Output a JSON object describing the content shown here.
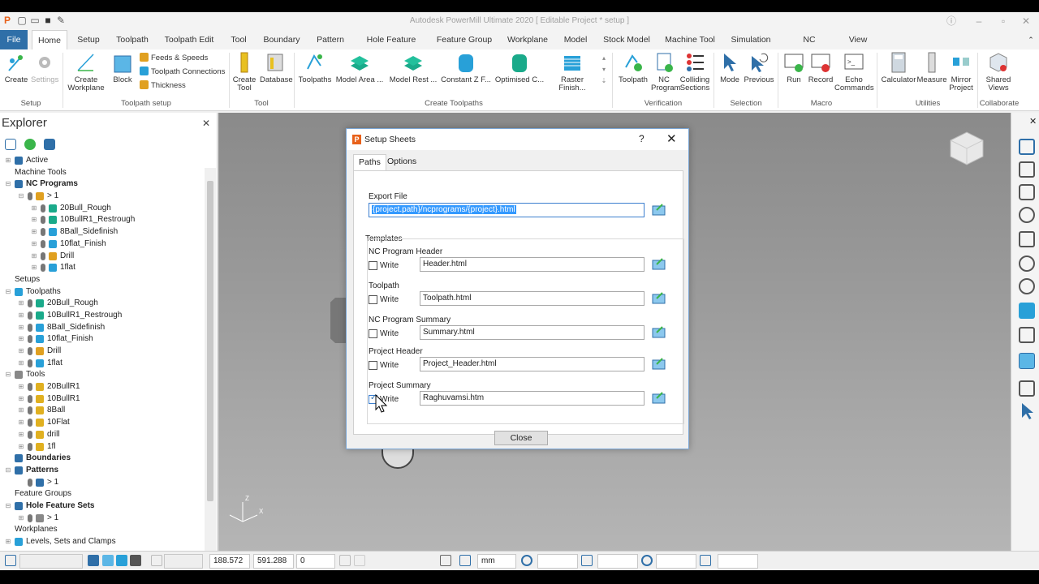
{
  "app": {
    "title": "Autodesk PowerMill Ultimate 2020   [ Editable Project * setup ]"
  },
  "ribbon": {
    "tabs": [
      "File",
      "Home",
      "Setup",
      "Toolpath",
      "Toolpath Edit",
      "Tool",
      "Boundary",
      "Pattern",
      "Hole Feature Set",
      "Feature Group",
      "Workplane",
      "Model",
      "Stock Model",
      "Machine Tool",
      "Simulation",
      "NC Program",
      "View"
    ],
    "groups": {
      "setup": "Setup",
      "toolpath_setup": "Toolpath setup",
      "tool": "Tool",
      "create_toolpaths": "Create Toolpaths",
      "verification": "Verification",
      "selection": "Selection",
      "macro": "Macro",
      "utilities": "Utilities",
      "collaborate": "Collaborate"
    },
    "buttons": {
      "create": "Create",
      "settings": "Settings",
      "create_workplane": "Create Workplane",
      "block": "Block",
      "feeds": "Feeds & Speeds",
      "connections": "Toolpath Connections",
      "thickness": "Thickness",
      "create_tool": "Create Tool",
      "database": "Database",
      "toolpaths": "Toolpaths",
      "model_area": "Model Area ...",
      "model_rest": "Model Rest ...",
      "constant_z": "Constant Z F...",
      "optimised": "Optimised C...",
      "raster": "Raster Finish...",
      "toolpath_v": "Toolpath",
      "nc_program": "NC Program",
      "colliding": "Colliding Sections",
      "mode": "Mode",
      "previous": "Previous",
      "run": "Run",
      "record": "Record",
      "echo": "Echo Commands",
      "calculator": "Calculator",
      "measure": "Measure",
      "mirror": "Mirror Project",
      "shared": "Shared Views"
    }
  },
  "explorer": {
    "title": "Explorer",
    "items": [
      {
        "label": "Active",
        "indent": 0,
        "pm": "+",
        "color": "#2f6fa8",
        "bold": false
      },
      {
        "label": "Machine Tools",
        "indent": 0,
        "pm": "",
        "color": "",
        "bold": false
      },
      {
        "label": "NC Programs",
        "indent": 0,
        "pm": "−",
        "color": "#2f6fa8",
        "bold": true
      },
      {
        "label": "> 1",
        "indent": 1,
        "pm": "−",
        "color": "#e0a020",
        "bold": false
      },
      {
        "label": "20Bull_Rough",
        "indent": 2,
        "pm": "+",
        "color": "#1aaa8a",
        "bold": false
      },
      {
        "label": "10BullR1_Restrough",
        "indent": 2,
        "pm": "+",
        "color": "#1aaa8a",
        "bold": false
      },
      {
        "label": "8Ball_Sidefinish",
        "indent": 2,
        "pm": "+",
        "color": "#28a0d8",
        "bold": false
      },
      {
        "label": "10flat_Finish",
        "indent": 2,
        "pm": "+",
        "color": "#28a0d8",
        "bold": false
      },
      {
        "label": "Drill",
        "indent": 2,
        "pm": "+",
        "color": "#e0a020",
        "bold": false
      },
      {
        "label": "1flat",
        "indent": 2,
        "pm": "+",
        "color": "#28a0d8",
        "bold": false
      },
      {
        "label": "Setups",
        "indent": 0,
        "pm": "",
        "color": "",
        "bold": false
      },
      {
        "label": "Toolpaths",
        "indent": 0,
        "pm": "−",
        "color": "#28a0d8",
        "bold": false
      },
      {
        "label": "20Bull_Rough",
        "indent": 1,
        "pm": "+",
        "color": "#1aaa8a",
        "bold": false
      },
      {
        "label": "10BullR1_Restrough",
        "indent": 1,
        "pm": "+",
        "color": "#1aaa8a",
        "bold": false
      },
      {
        "label": "8Ball_Sidefinish",
        "indent": 1,
        "pm": "+",
        "color": "#28a0d8",
        "bold": false
      },
      {
        "label": "10flat_Finish",
        "indent": 1,
        "pm": "+",
        "color": "#28a0d8",
        "bold": false
      },
      {
        "label": "Drill",
        "indent": 1,
        "pm": "+",
        "color": "#e0a020",
        "bold": false
      },
      {
        "label": "1flat",
        "indent": 1,
        "pm": "+",
        "color": "#28a0d8",
        "bold": false
      },
      {
        "label": "Tools",
        "indent": 0,
        "pm": "−",
        "color": "#888888",
        "bold": false
      },
      {
        "label": "20BullR1",
        "indent": 1,
        "pm": "+",
        "color": "#e0b020",
        "bold": false
      },
      {
        "label": "10BullR1",
        "indent": 1,
        "pm": "+",
        "color": "#e0b020",
        "bold": false
      },
      {
        "label": "8Ball",
        "indent": 1,
        "pm": "+",
        "color": "#e0b020",
        "bold": false
      },
      {
        "label": "10Flat",
        "indent": 1,
        "pm": "+",
        "color": "#e0b020",
        "bold": false
      },
      {
        "label": "drill",
        "indent": 1,
        "pm": "+",
        "color": "#e0b020",
        "bold": false
      },
      {
        "label": "1fl",
        "indent": 1,
        "pm": "+",
        "color": "#e0b020",
        "bold": false
      },
      {
        "label": "Boundaries",
        "indent": 0,
        "pm": "",
        "color": "#2f6fa8",
        "bold": true
      },
      {
        "label": "Patterns",
        "indent": 0,
        "pm": "−",
        "color": "#2f6fa8",
        "bold": true
      },
      {
        "label": "> 1",
        "indent": 1,
        "pm": "",
        "color": "#2f6fa8",
        "bold": false
      },
      {
        "label": "Feature Groups",
        "indent": 0,
        "pm": "",
        "color": "",
        "bold": false
      },
      {
        "label": "Hole Feature Sets",
        "indent": 0,
        "pm": "−",
        "color": "#2f6fa8",
        "bold": true
      },
      {
        "label": "> 1",
        "indent": 1,
        "pm": "+",
        "color": "#888888",
        "bold": false
      },
      {
        "label": "Workplanes",
        "indent": 0,
        "pm": "",
        "color": "",
        "bold": false
      },
      {
        "label": "Levels, Sets and Clamps",
        "indent": 0,
        "pm": "+",
        "color": "#28a0d8",
        "bold": false
      }
    ]
  },
  "status": {
    "x": "188.572",
    "y": "591.288",
    "z": "0",
    "units": "mm"
  },
  "triad": {
    "z": "Z",
    "x": "X"
  },
  "dialog": {
    "title": "Setup Sheets",
    "help": "?",
    "close_x": "✕",
    "tabs": [
      "Paths",
      "Options"
    ],
    "export_label": "Export File",
    "export_value": "{project.path}/ncprograms/{project}.html",
    "templates_label": "Templates",
    "write_label": "Write",
    "templates": [
      {
        "label": "NC Program Header",
        "value": "Header.html",
        "checked": false
      },
      {
        "label": "Toolpath",
        "value": "Toolpath.html",
        "checked": false
      },
      {
        "label": "NC Program Summary",
        "value": "Summary.html",
        "checked": false
      },
      {
        "label": "Project Header",
        "value": "Project_Header.html",
        "checked": false
      },
      {
        "label": "Project Summary",
        "value": "Raghuvamsi.htm",
        "checked": true
      }
    ],
    "close_button": "Close"
  },
  "colors": {
    "accent": "#2f6fa8",
    "viewport": "#9a9a9a",
    "dialog_border": "#7aa6d6"
  }
}
